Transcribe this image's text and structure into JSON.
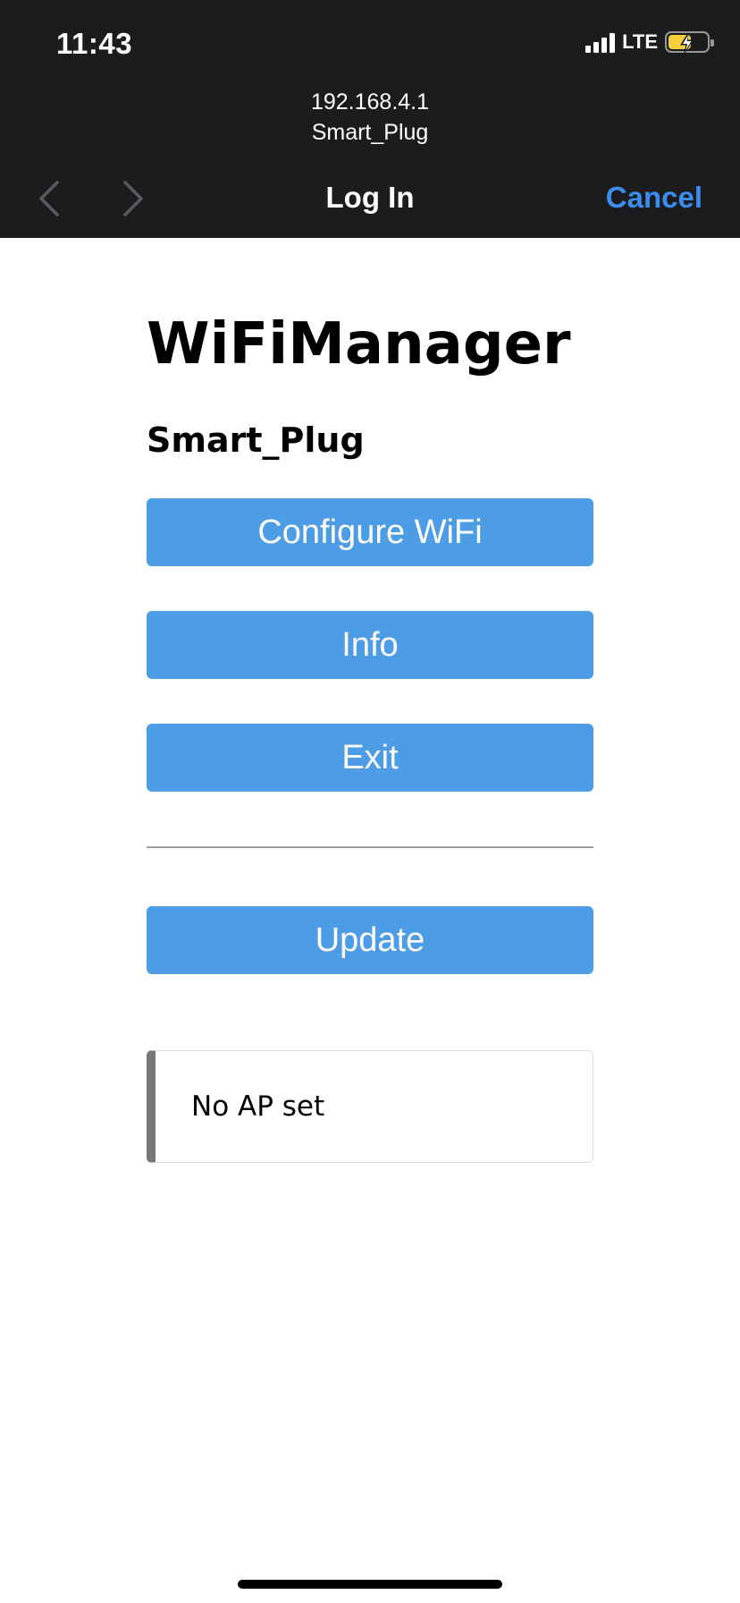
{
  "status_bar": {
    "time": "11:43",
    "network": "LTE",
    "signal_bars": 4,
    "battery_charging": true,
    "battery_level": 0.6,
    "battery_color": "#f5cf3d"
  },
  "browser": {
    "host": "192.168.4.1",
    "page_title": "Smart_Plug",
    "nav_title": "Log In",
    "cancel_label": "Cancel",
    "accent_color": "#3b8df0"
  },
  "page": {
    "title": "WiFiManager",
    "subtitle": "Smart_Plug",
    "buttons": [
      {
        "label": "Configure WiFi"
      },
      {
        "label": "Info"
      },
      {
        "label": "Exit"
      },
      {
        "label": "Update"
      }
    ],
    "button_color": "#4d9de6",
    "message": "No AP set"
  }
}
